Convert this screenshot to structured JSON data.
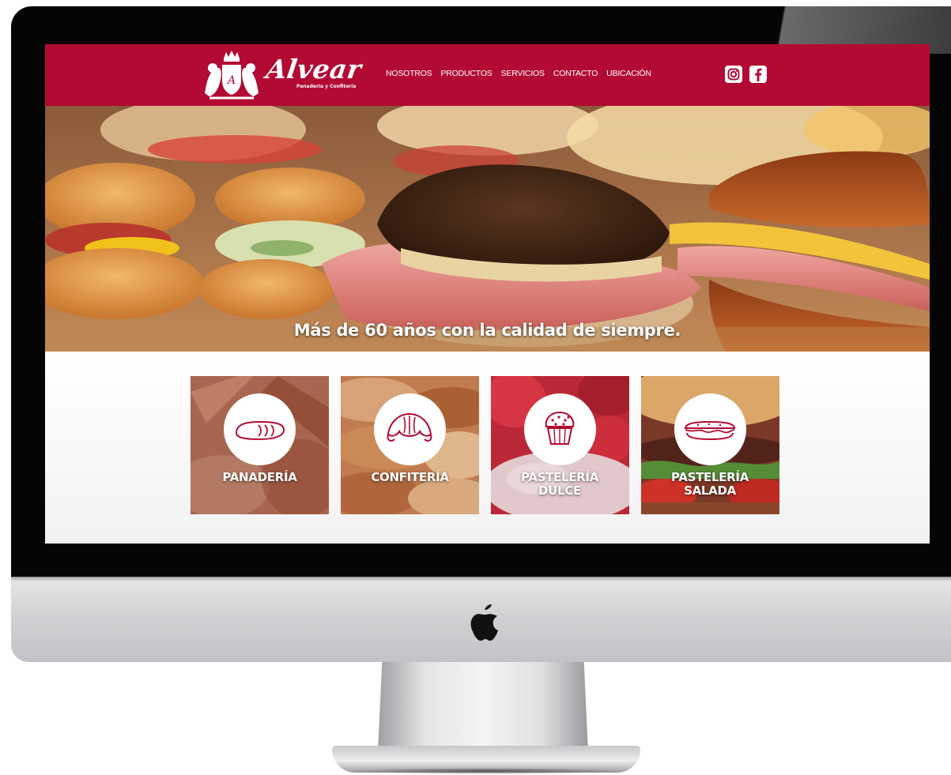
{
  "brand": {
    "name": "Alvear",
    "tagline": "Panadería y Confitería"
  },
  "nav": {
    "items": [
      {
        "label": "NOSOTROS"
      },
      {
        "label": "PRODUCTOS"
      },
      {
        "label": "SERVICIOS"
      },
      {
        "label": "CONTACTO"
      },
      {
        "label": "UBICACIÓN"
      }
    ]
  },
  "social": {
    "icons": [
      "instagram-icon",
      "facebook-icon"
    ]
  },
  "hero": {
    "tagline": "Más de 60 años con la calidad de siempre."
  },
  "categories": [
    {
      "label": "PANADERÍA",
      "icon": "bread-icon"
    },
    {
      "label": "CONFITERÍA",
      "icon": "croissant-icon"
    },
    {
      "label": "PASTELERÍA DULCE",
      "icon": "cupcake-icon"
    },
    {
      "label": "PASTELERÍA SALADA",
      "icon": "sandwich-icon"
    }
  ],
  "colors": {
    "brand_red": "#b20a33",
    "white": "#ffffff",
    "bezel": "#050505",
    "aluminum": "#d1d2d4"
  }
}
